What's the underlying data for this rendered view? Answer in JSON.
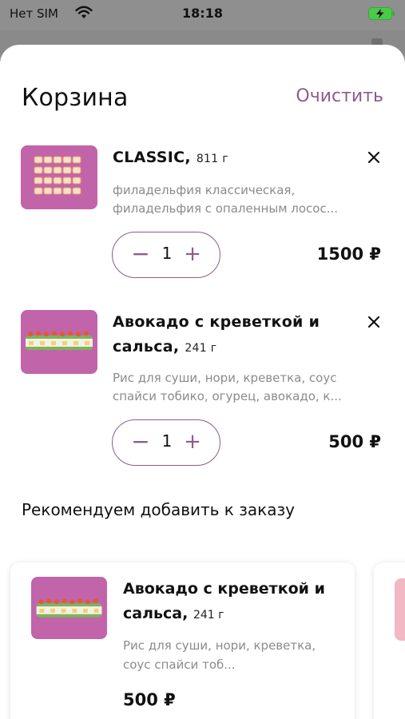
{
  "status": {
    "carrier": "Нет SIM",
    "time": "18:18"
  },
  "header": {
    "title": "Корзина",
    "clear_label": "Очистить"
  },
  "cart": {
    "items": [
      {
        "title": "CLASSIC,",
        "weight": "811 г",
        "description": "филадельфия классическая, филадельфия с опаленным лосос...",
        "quantity": "1",
        "price": "1500 ₽",
        "minus": "−",
        "plus": "+"
      },
      {
        "title": "Авокадо с креветкой и сальса,",
        "weight": "241 г",
        "description": "Рис для суши, нори, креветка, соус спайси тобико, огурец, авокадо, к...",
        "quantity": "1",
        "price": "500 ₽",
        "minus": "−",
        "plus": "+"
      }
    ]
  },
  "recommend": {
    "title": "Рекомендуем добавить к заказу",
    "items": [
      {
        "title": "Авокадо с креветкой и сальса,",
        "weight": "241 г",
        "description": "Рис для суши, нори, креветка, соус спайси тоб...",
        "price": "500 ₽"
      }
    ]
  },
  "colors": {
    "accent": "#8e5c8a",
    "thumb_bg": "#c264aa"
  },
  "icons": {
    "remove": "close-icon",
    "wifi": "wifi-icon",
    "battery": "battery-charging-icon"
  }
}
